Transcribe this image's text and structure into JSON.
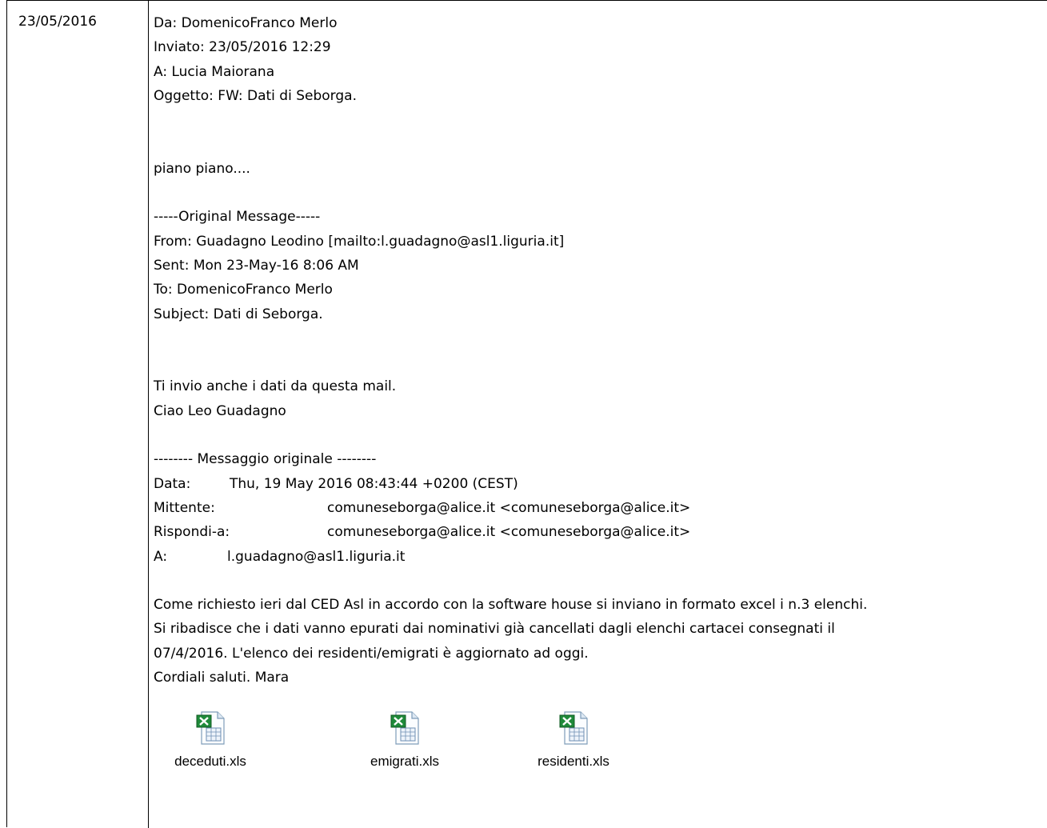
{
  "date": "23/05/2016",
  "header": {
    "from": "Da: DomenicoFranco Merlo",
    "sent": "Inviato: 23/05/2016 12:29",
    "to": "A: Lucia Maiorana",
    "subject": "Oggetto: FW: Dati di Seborga."
  },
  "body_line": "piano piano....",
  "forward1": {
    "separator": "-----Original Message-----",
    "from": "From: Guadagno Leodino [mailto:l.guadagno@asl1.liguria.it]",
    "sent": "Sent: Mon 23-May-16 8:06 AM",
    "to": "To: DomenicoFranco Merlo",
    "subject": "Subject: Dati di Seborga.",
    "body": [
      "Ti invio anche i dati da questa mail.",
      "Ciao Leo Guadagno"
    ]
  },
  "forward2": {
    "separator": "-------- Messaggio originale --------",
    "fields": [
      {
        "label": "Data:",
        "value": "Thu, 19 May 2016 08:43:44 +0200 (CEST)"
      },
      {
        "label": "Mittente:",
        "value": "comuneseborga@alice.it <comuneseborga@alice.it>"
      },
      {
        "label": "Rispondi-a:",
        "value": "comuneseborga@alice.it <comuneseborga@alice.it>"
      },
      {
        "label": "A:",
        "value": "l.guadagno@asl1.liguria.it"
      }
    ],
    "body": [
      "Come richiesto ieri dal CED Asl in accordo con la software house si inviano in formato excel i n.3 elenchi.",
      "Si ribadisce che i dati vanno epurati dai nominativi già cancellati dagli elenchi cartacei consegnati il",
      "07/4/2016. L'elenco dei residenti/emigrati è aggiornato ad oggi.",
      "Cordiali saluti. Mara"
    ]
  },
  "attachments": [
    {
      "name": "deceduti.xls",
      "icon": "excel-file-icon"
    },
    {
      "name": "emigrati.xls",
      "icon": "excel-file-icon"
    },
    {
      "name": "residenti.xls",
      "icon": "excel-file-icon"
    }
  ]
}
